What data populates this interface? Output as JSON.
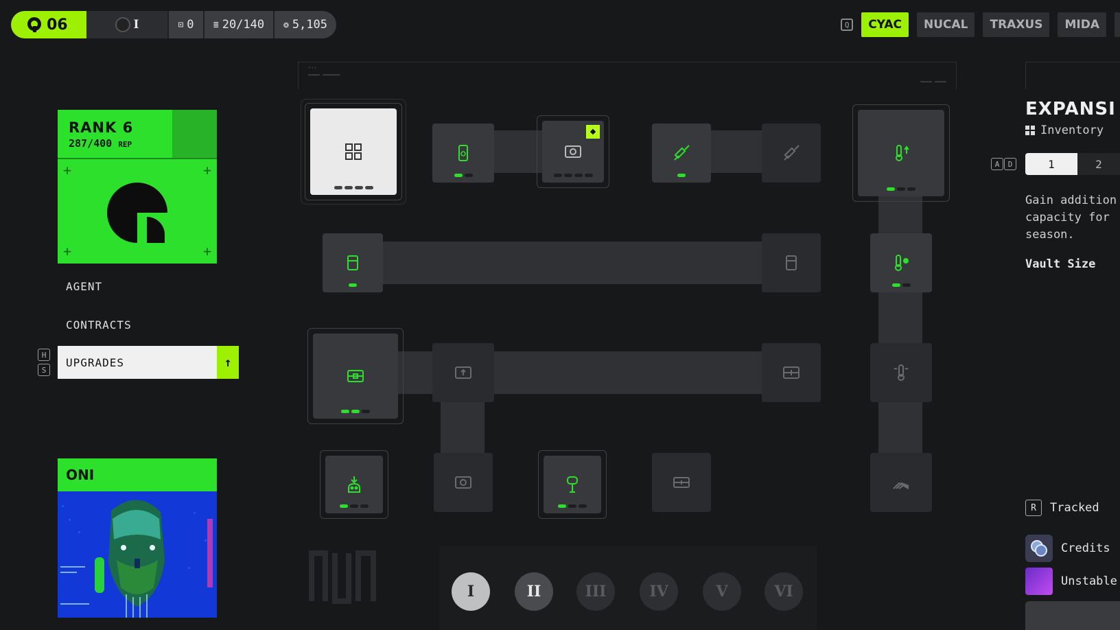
{
  "topbar": {
    "rank_level": "06",
    "player_label": "I",
    "vault_count": "0",
    "inventory": "20/140",
    "credits": "5,105"
  },
  "factions": {
    "key_hint": "Q",
    "items": [
      "CYAC",
      "NUCAL",
      "TRAXUS",
      "MIDA"
    ],
    "active": "CYAC"
  },
  "rank_card": {
    "title": "RANK 6",
    "rep_value": "287/400",
    "rep_unit": "REP"
  },
  "menu": {
    "agent": "AGENT",
    "contracts": "CONTRACTS",
    "upgrades": "UPGRADES",
    "key_up": "H",
    "key_down": "S"
  },
  "agent_card": {
    "name": "ONI"
  },
  "tree": {
    "node_ranks": [
      {
        "name": "grid",
        "filled": 4,
        "total": 4
      },
      {
        "name": "phone",
        "filled": 1,
        "total": 2
      },
      {
        "name": "vault",
        "filled": 4,
        "total": 4
      },
      {
        "name": "syringe",
        "filled": 1,
        "total": 1
      },
      {
        "name": "thermo-up",
        "filled": 1,
        "total": 3
      },
      {
        "name": "canister",
        "filled": 1,
        "total": 1
      },
      {
        "name": "thermo-drop",
        "filled": 1,
        "total": 2
      },
      {
        "name": "stash",
        "filled": 2,
        "total": 3
      },
      {
        "name": "bot",
        "filled": 1,
        "total": 3
      },
      {
        "name": "signal",
        "filled": 1,
        "total": 3
      }
    ]
  },
  "tiers": {
    "labels": [
      "I",
      "II",
      "III",
      "IV",
      "V",
      "VI"
    ],
    "selected": "I",
    "current": "II"
  },
  "details": {
    "title": "EXPANSI",
    "category": "Inventory",
    "page_keys": [
      "A",
      "D"
    ],
    "pages": [
      "1",
      "2"
    ],
    "active_page": "1",
    "description": "Gain addition\ncapacity for\nseason.",
    "stat_label": "Vault Size",
    "tracked_key": "R",
    "tracked_label": "Tracked",
    "costs": [
      "Credits",
      "Unstable"
    ]
  },
  "colors": {
    "accent": "#9cf000",
    "agent_green": "#2ce02c",
    "background": "#17181a",
    "node": "#38393c"
  }
}
